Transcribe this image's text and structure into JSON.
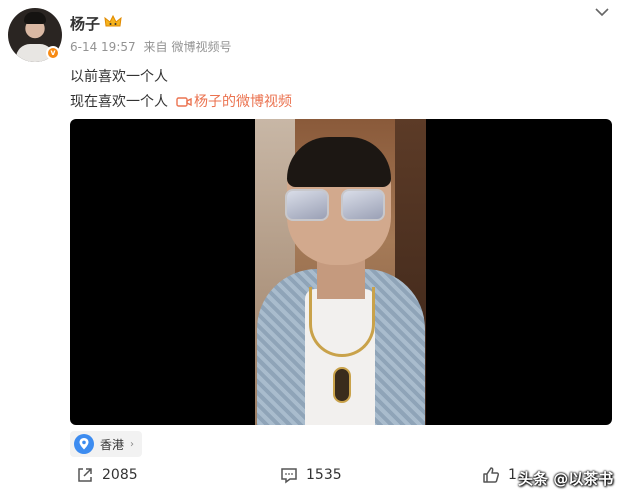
{
  "post": {
    "username": "杨子",
    "time": "6-14 19:57",
    "source_prefix": "来自",
    "source": "微博视频号",
    "text_line1": "以前喜欢一个人",
    "text_line2": "现在喜欢一个人",
    "video_link": "杨子的微博视频"
  },
  "location": {
    "label": "香港",
    "arrow": "›"
  },
  "actions": {
    "share_count": "2085",
    "comment_count": "1535",
    "like_count": "1."
  },
  "watermark": "头条 @以茶书",
  "colors": {
    "accent": "#eb7350",
    "badge": "#f78a13",
    "meta": "#939393"
  },
  "icons": [
    "crown-icon",
    "chevron-down-icon",
    "video-link-icon",
    "location-pin-icon",
    "share-icon",
    "comment-icon",
    "like-icon",
    "verified-badge-icon"
  ]
}
